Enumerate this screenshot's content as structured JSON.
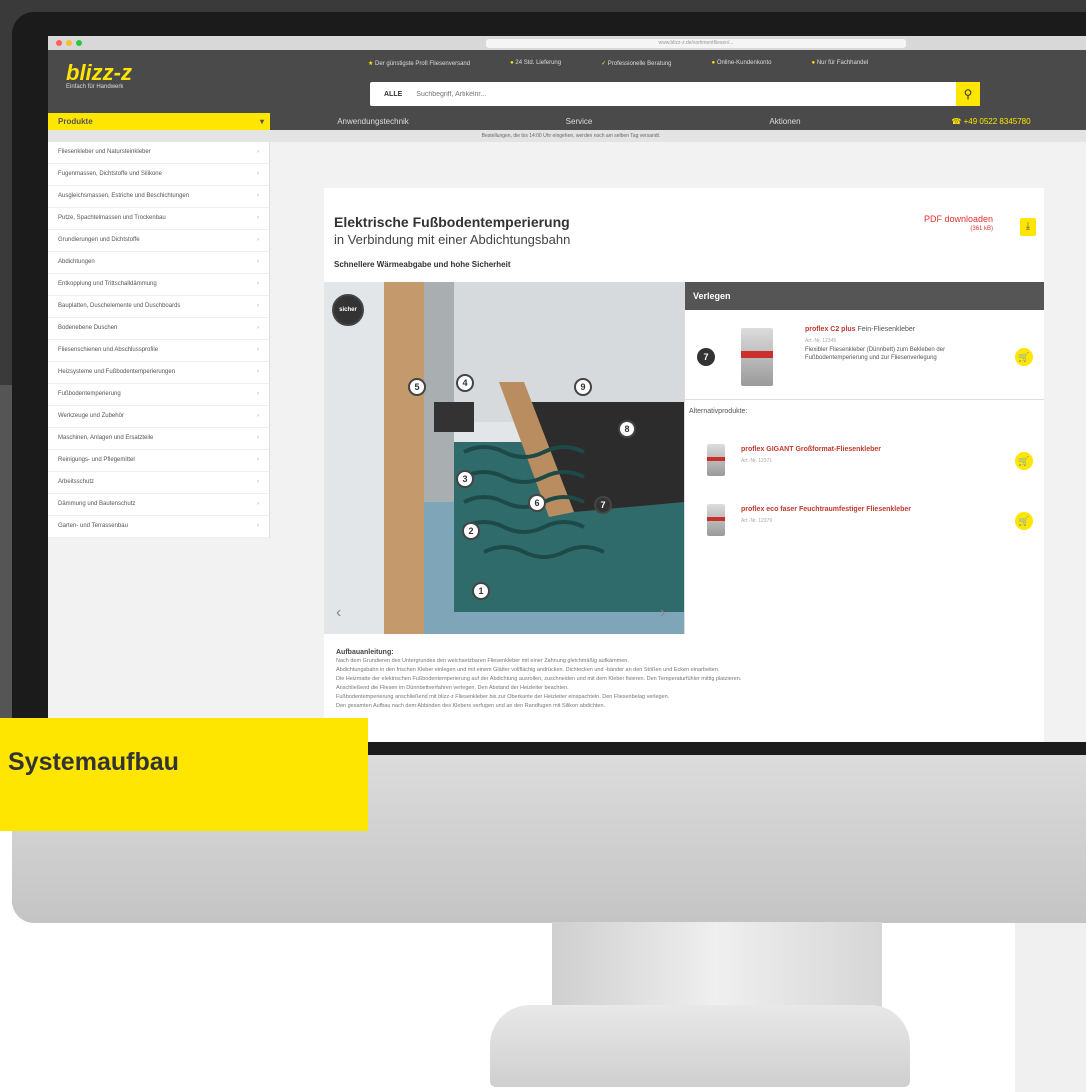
{
  "browser": {
    "url": "www.blizz-z.de/sortimentfliesen/..."
  },
  "logo": {
    "name": "blizz-z",
    "tagline": "Einfach für Handwerk"
  },
  "usps": [
    {
      "label": "Der günstigste Profi Fliesenversand"
    },
    {
      "label": "24 Std. Lieferung"
    },
    {
      "label": "Professionelle Beratung"
    },
    {
      "label": "Online-Kundenkonto"
    },
    {
      "label": "Nur für Fachhandel"
    }
  ],
  "search": {
    "category": "ALLE",
    "placeholder": "Suchbegriff, Artikelnr..."
  },
  "nav": {
    "products": "Produkte",
    "items": [
      "Anwendungstechnik",
      "Service",
      "Aktionen"
    ],
    "phone": "+49 0522 8345780"
  },
  "notice": "Bestellungen, die bis 14:00 Uhr eingehen, werden noch am selben Tag versandt.",
  "sidebar": [
    "Fliesenkleber und Natursteinkleber",
    "Fugenmassen, Dichtstoffe und Silikone",
    "Ausgleichsmassen, Estriche und Beschichtungen",
    "Putze, Spachtelmassen und Trockenbau",
    "Grundierungen und Dichtstoffe",
    "Abdichtungen",
    "Entkopplung und Trittschalldämmung",
    "Bauplatten, Duschelemente und Duschboards",
    "Bodenebene Duschen",
    "Fliesenschienen und Abschlussprofile",
    "Heizsysteme und Fußbodentemperierungen",
    "Fußbodentemperierung",
    "Werkzeuge und Zubehör",
    "Maschinen, Anlagen und Ersatzteile",
    "Reinigungs- und Pflegemittel",
    "Arbeitsschutz",
    "Dämmung und Bautenschutz",
    "Garten- und Terrassenbau"
  ],
  "content": {
    "title1": "Elektrische Fußbodentemperierung",
    "title2": "in Verbindung mit einer Abdichtungsbahn",
    "subtitle": "Schnellere Wärmeabgabe und hohe Sicherheit",
    "pdf_label": "PDF downloaden",
    "pdf_size": "(361 kB)",
    "diagram_badge": "sicher",
    "diagram_numbers": [
      "1",
      "2",
      "3",
      "4",
      "5",
      "6",
      "7",
      "8",
      "9"
    ]
  },
  "panel": {
    "title": "Verlegen",
    "main_number": "7",
    "main_name": "proflex C2 plus",
    "main_suffix": "Fein-Fliesenkleber",
    "main_meta": "Art.-Nr. 12345",
    "main_desc": "Flexibler Fliesenkleber (Dünnbett) zum Bekleben der Fußbodentemperierung und zur Fliesenverlegung",
    "alt_label": "Alternativprodukte:",
    "alts": [
      {
        "name": "proflex GIGANT Großformat-Fliesenkleber",
        "meta": "Art.-Nr. 12371"
      },
      {
        "name": "proflex eco faser Feuchtraumfestiger Fliesenkleber",
        "meta": "Art.-Nr. 12379"
      }
    ]
  },
  "instructions": {
    "heading": "Aufbauanleitung:",
    "lines": [
      "Nach dem Grundieren des Untergrundes den weichsetzbaren Fliesenkleber mit einer Zahnung gleichmäßig aufkämmen.",
      "Abdichtungsbahn in den frischen Kleber einlegen und mit einem Glätter vollflächig andrücken. Dichtecken und -bänder an den Stößen und Ecken einarbeiten.",
      "Die Heizmatte der elektrischen Fußbodentemperierung auf der Abdichtung ausrollen, zuschneiden und mit dem Kleber fixieren. Den Temperaturfühler mittig platzieren.",
      "Anschließend die Fliesen im Dünnbettverfahren verlegen. Den Abstand der Heizleiter beachten.",
      "Fußbodentemperierung anschließend mit blizz-z Fliesenkleber bis zur Oberkante der Heizleiter einspachteln. Den Fliesenbelag verlegen.",
      "Den gesamten Aufbau nach dem Abbinden des Klebers verfugen und an den Randfugen mit Silikon abdichten."
    ]
  },
  "overlay": {
    "label": "Systemaufbau"
  }
}
